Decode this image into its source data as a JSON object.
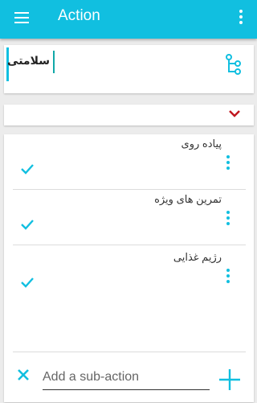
{
  "appbar": {
    "title": "Action",
    "color": "#11bfe0"
  },
  "action": {
    "title": "سلامتی"
  },
  "sub_actions": [
    {
      "label": "پیاده روی",
      "checked": true
    },
    {
      "label": "تمرین های ویژه",
      "checked": true
    },
    {
      "label": "رژیم غذایی",
      "checked": true
    }
  ],
  "new_sub_action": {
    "placeholder": "Add a sub-action",
    "value": ""
  },
  "icons": {
    "menu": "hamburger-menu-icon",
    "overflow": "overflow-menu-icon",
    "tree": "tree-structure-icon",
    "expand": "chevron-down-icon",
    "check": "check-icon",
    "item_menu": "more-vert-icon",
    "close": "close-icon",
    "add": "plus-icon"
  },
  "colors": {
    "accent": "#11bfe0",
    "chevron": "#c0171f",
    "check": "#11bfe0"
  }
}
